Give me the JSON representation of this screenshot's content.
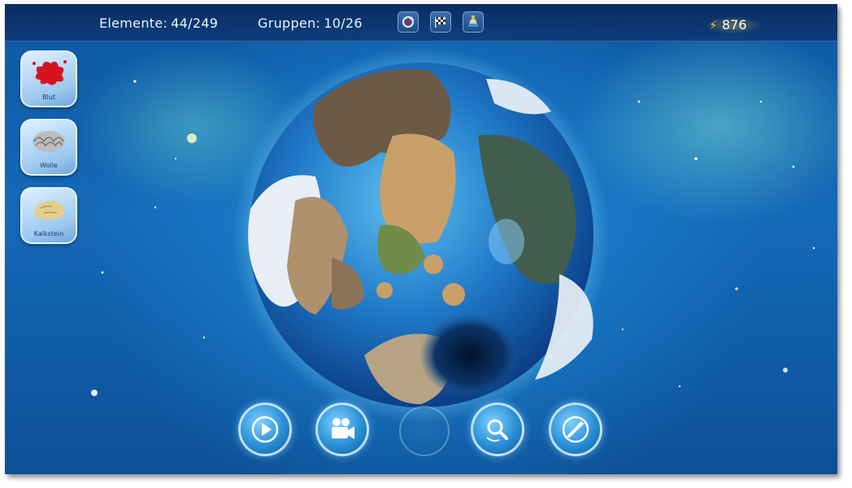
{
  "hud": {
    "elements_label": "Elemente:",
    "elements_value": "44/249",
    "groups_label": "Gruppen:",
    "groups_value": "10/26",
    "energy_value": "876"
  },
  "toolbar_icons": [
    "refresh-icon",
    "checkered-flag-icon",
    "potion-icon"
  ],
  "sidebar": {
    "items": [
      {
        "label": "Blut",
        "icon": "blood-splat-icon"
      },
      {
        "label": "Wolle",
        "icon": "wool-icon"
      },
      {
        "label": "Kalkstein",
        "icon": "limestone-icon"
      }
    ]
  },
  "bottom_controls": [
    "play-icon",
    "movie-camera-icon",
    "empty-slot",
    "search-rotate-icon",
    "wand-icon"
  ],
  "colors": {
    "accent": "#2a8fd6",
    "energy": "#f3c623",
    "blood": "#d6141e"
  }
}
